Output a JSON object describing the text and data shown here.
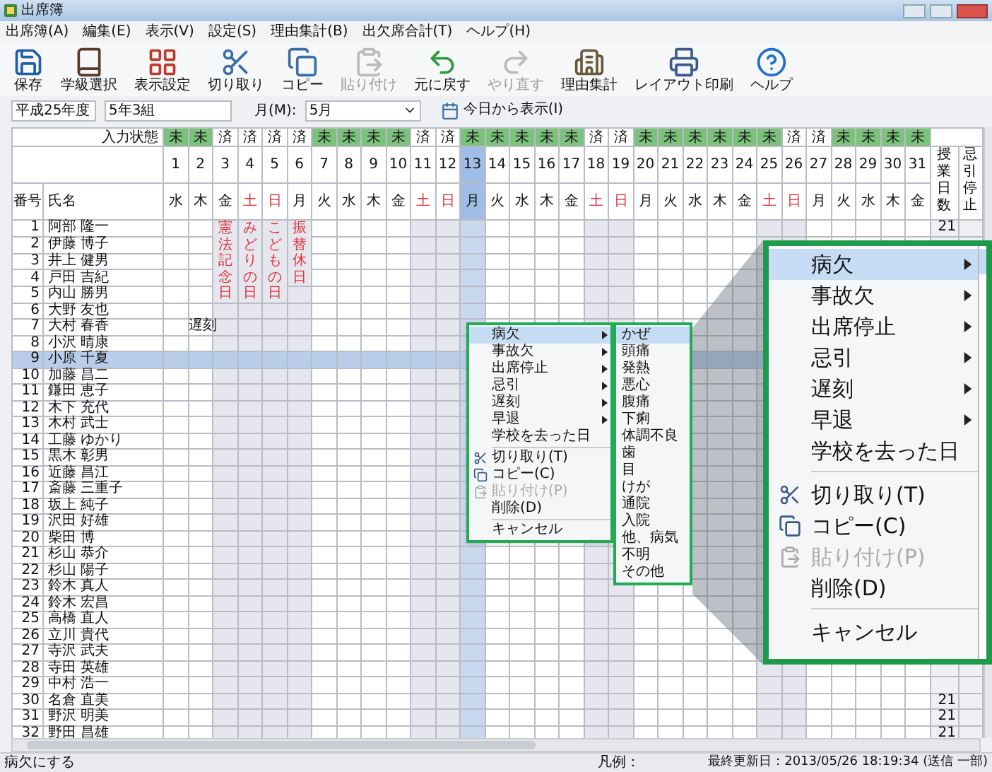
{
  "window": {
    "title": "出席簿"
  },
  "menu_bar": [
    "出席簿(A)",
    "編集(E)",
    "表示(V)",
    "設定(S)",
    "理由集計(B)",
    "出欠席合計(T)",
    "ヘルプ(H)"
  ],
  "toolbar": [
    {
      "label": "保存",
      "kind": "save",
      "disabled": false
    },
    {
      "label": "学級選択",
      "kind": "book",
      "disabled": false
    },
    {
      "label": "表示設定",
      "kind": "grid",
      "disabled": false
    },
    {
      "label": "切り取り",
      "kind": "cut",
      "disabled": false
    },
    {
      "label": "コピー",
      "kind": "copy",
      "disabled": false
    },
    {
      "label": "貼り付け",
      "kind": "paste",
      "disabled": true
    },
    {
      "label": "元に戻す",
      "kind": "undo",
      "disabled": false
    },
    {
      "label": "やり直す",
      "kind": "redo",
      "disabled": true
    },
    {
      "label": "理由集計",
      "kind": "report",
      "disabled": false
    },
    {
      "label": "レイアウト印刷",
      "kind": "print",
      "disabled": false
    },
    {
      "label": "ヘルプ",
      "kind": "help",
      "disabled": false
    }
  ],
  "info_bar": {
    "year": "平成25年度",
    "class": "5年3組",
    "month_label": "月(M):",
    "month_value": "5月",
    "today_button": "今日から表示(I)"
  },
  "grid": {
    "status_label": "入力状態",
    "number_header": "番号",
    "name_header": "氏名",
    "summary_headers": [
      "授業日数",
      "忌引停止"
    ],
    "days": [
      {
        "day": "1",
        "weekday": "水",
        "status": "未",
        "highlighted": true,
        "kind": "school",
        "selected": false
      },
      {
        "day": "2",
        "weekday": "木",
        "status": "未",
        "highlighted": true,
        "kind": "school",
        "selected": false
      },
      {
        "day": "3",
        "weekday": "金",
        "status": "済",
        "highlighted": false,
        "kind": "holiday",
        "selected": false,
        "holiday_text": "憲法記念日"
      },
      {
        "day": "4",
        "weekday": "土",
        "status": "済",
        "highlighted": false,
        "kind": "weekend",
        "selected": false,
        "holiday_text": "みどりの日"
      },
      {
        "day": "5",
        "weekday": "日",
        "status": "済",
        "highlighted": false,
        "kind": "weekend",
        "selected": false,
        "holiday_text": "こどもの日"
      },
      {
        "day": "6",
        "weekday": "月",
        "status": "済",
        "highlighted": false,
        "kind": "holiday",
        "selected": false,
        "holiday_text": "振替休日"
      },
      {
        "day": "7",
        "weekday": "火",
        "status": "未",
        "highlighted": true,
        "kind": "school",
        "selected": false
      },
      {
        "day": "8",
        "weekday": "水",
        "status": "未",
        "highlighted": true,
        "kind": "school",
        "selected": false
      },
      {
        "day": "9",
        "weekday": "木",
        "status": "未",
        "highlighted": true,
        "kind": "school",
        "selected": false
      },
      {
        "day": "10",
        "weekday": "金",
        "status": "未",
        "highlighted": true,
        "kind": "school",
        "selected": false
      },
      {
        "day": "11",
        "weekday": "土",
        "status": "済",
        "highlighted": false,
        "kind": "weekend",
        "selected": false
      },
      {
        "day": "12",
        "weekday": "日",
        "status": "済",
        "highlighted": false,
        "kind": "weekend",
        "selected": false
      },
      {
        "day": "13",
        "weekday": "月",
        "status": "未",
        "highlighted": true,
        "kind": "school",
        "selected": true
      },
      {
        "day": "14",
        "weekday": "火",
        "status": "未",
        "highlighted": true,
        "kind": "school",
        "selected": false
      },
      {
        "day": "15",
        "weekday": "水",
        "status": "未",
        "highlighted": true,
        "kind": "school",
        "selected": false
      },
      {
        "day": "16",
        "weekday": "木",
        "status": "未",
        "highlighted": true,
        "kind": "school",
        "selected": false
      },
      {
        "day": "17",
        "weekday": "金",
        "status": "未",
        "highlighted": true,
        "kind": "school",
        "selected": false
      },
      {
        "day": "18",
        "weekday": "土",
        "status": "済",
        "highlighted": false,
        "kind": "weekend",
        "selected": false
      },
      {
        "day": "19",
        "weekday": "日",
        "status": "済",
        "highlighted": false,
        "kind": "weekend",
        "selected": false
      },
      {
        "day": "20",
        "weekday": "月",
        "status": "未",
        "highlighted": true,
        "kind": "school",
        "selected": false
      },
      {
        "day": "21",
        "weekday": "火",
        "status": "未",
        "highlighted": true,
        "kind": "school",
        "selected": false
      },
      {
        "day": "22",
        "weekday": "水",
        "status": "未",
        "highlighted": true,
        "kind": "school",
        "selected": false
      },
      {
        "day": "23",
        "weekday": "木",
        "status": "未",
        "highlighted": true,
        "kind": "school",
        "selected": false
      },
      {
        "day": "24",
        "weekday": "金",
        "status": "未",
        "highlighted": true,
        "kind": "school",
        "selected": false
      },
      {
        "day": "25",
        "weekday": "土",
        "status": "未",
        "highlighted": true,
        "kind": "weekend",
        "selected": false
      },
      {
        "day": "26",
        "weekday": "日",
        "status": "済",
        "highlighted": false,
        "kind": "weekend",
        "selected": false
      },
      {
        "day": "27",
        "weekday": "月",
        "status": "済",
        "highlighted": false,
        "kind": "school",
        "selected": false
      },
      {
        "day": "28",
        "weekday": "火",
        "status": "未",
        "highlighted": true,
        "kind": "school",
        "selected": false
      },
      {
        "day": "29",
        "weekday": "水",
        "status": "未",
        "highlighted": true,
        "kind": "school",
        "selected": false
      },
      {
        "day": "30",
        "weekday": "木",
        "status": "未",
        "highlighted": true,
        "kind": "school",
        "selected": false
      },
      {
        "day": "31",
        "weekday": "金",
        "status": "未",
        "highlighted": true,
        "kind": "school",
        "selected": false
      }
    ],
    "students": [
      {
        "number": "1",
        "name": "阿部 隆一",
        "selected": false,
        "total": "21"
      },
      {
        "number": "2",
        "name": "伊藤 博子",
        "selected": false
      },
      {
        "number": "3",
        "name": "井上 健男",
        "selected": false
      },
      {
        "number": "4",
        "name": "戸田 吉紀",
        "selected": false
      },
      {
        "number": "5",
        "name": "内山 勝男",
        "selected": false
      },
      {
        "number": "6",
        "name": "大野 友也",
        "selected": false
      },
      {
        "number": "7",
        "name": "大村 春香",
        "selected": false,
        "day_notes": [
          {
            "kind": "blank"
          },
          {
            "kind": "text",
            "text": "遅刻"
          }
        ]
      },
      {
        "number": "8",
        "name": "小沢 晴康",
        "selected": false
      },
      {
        "number": "9",
        "name": "小原 千夏",
        "selected": true
      },
      {
        "number": "10",
        "name": "加藤 昌二",
        "selected": false
      },
      {
        "number": "11",
        "name": "鎌田 恵子",
        "selected": false
      },
      {
        "number": "12",
        "name": "木下 充代",
        "selected": false
      },
      {
        "number": "13",
        "name": "木村 武士",
        "selected": false
      },
      {
        "number": "14",
        "name": "工藤 ゆかり",
        "selected": false
      },
      {
        "number": "15",
        "name": "黒木 彰男",
        "selected": false
      },
      {
        "number": "16",
        "name": "近藤 昌江",
        "selected": false
      },
      {
        "number": "17",
        "name": "斎藤 三重子",
        "selected": false
      },
      {
        "number": "18",
        "name": "坂上 純子",
        "selected": false
      },
      {
        "number": "19",
        "name": "沢田 好雄",
        "selected": false
      },
      {
        "number": "20",
        "name": "柴田 博",
        "selected": false
      },
      {
        "number": "21",
        "name": "杉山 恭介",
        "selected": false
      },
      {
        "number": "22",
        "name": "杉山 陽子",
        "selected": false
      },
      {
        "number": "23",
        "name": "鈴木 真人",
        "selected": false
      },
      {
        "number": "24",
        "name": "鈴木 宏昌",
        "selected": false
      },
      {
        "number": "25",
        "name": "高橋 直人",
        "selected": false
      },
      {
        "number": "26",
        "name": "立川 貴代",
        "selected": false
      },
      {
        "number": "27",
        "name": "寺沢 武夫",
        "selected": false
      },
      {
        "number": "28",
        "name": "寺田 英雄",
        "selected": false
      },
      {
        "number": "29",
        "name": "中村 浩一",
        "selected": false
      },
      {
        "number": "30",
        "name": "名倉 直美",
        "selected": false,
        "total": "21"
      },
      {
        "number": "31",
        "name": "野沢 明美",
        "selected": false,
        "total": "21"
      },
      {
        "number": "32",
        "name": "野田 昌雄",
        "selected": false,
        "total": "21"
      }
    ]
  },
  "context_menu": [
    {
      "label": "病欠",
      "kind": "submenu",
      "selected": true,
      "disabled": false
    },
    {
      "label": "事故欠",
      "kind": "submenu",
      "selected": false,
      "disabled": false
    },
    {
      "label": "出席停止",
      "kind": "submenu",
      "selected": false,
      "disabled": false
    },
    {
      "label": "忌引",
      "kind": "submenu",
      "selected": false,
      "disabled": false
    },
    {
      "label": "遅刻",
      "kind": "submenu",
      "selected": false,
      "disabled": false
    },
    {
      "label": "早退",
      "kind": "submenu",
      "selected": false,
      "disabled": false
    },
    {
      "label": "学校を去った日",
      "kind": "plain",
      "selected": false,
      "disabled": false
    },
    {
      "label": "切り取り(T)",
      "kind": "cut",
      "selected": false,
      "disabled": false,
      "separator_before": true
    },
    {
      "label": "コピー(C)",
      "kind": "copy",
      "selected": false,
      "disabled": false
    },
    {
      "label": "貼り付け(P)",
      "kind": "paste",
      "selected": false,
      "disabled": true
    },
    {
      "label": "削除(D)",
      "kind": "plain",
      "selected": false,
      "disabled": false
    },
    {
      "label": "キャンセル",
      "kind": "plain",
      "selected": false,
      "disabled": false,
      "separator_before": true
    }
  ],
  "reason_submenu": [
    {
      "label": "かぜ",
      "selected": true
    },
    {
      "label": "頭痛",
      "selected": false
    },
    {
      "label": "発熱",
      "selected": false
    },
    {
      "label": "悪心",
      "selected": false
    },
    {
      "label": "腹痛",
      "selected": false
    },
    {
      "label": "下痢",
      "selected": false
    },
    {
      "label": "体調不良",
      "selected": false
    },
    {
      "label": "歯",
      "selected": false
    },
    {
      "label": "目",
      "selected": false
    },
    {
      "label": "けが",
      "selected": false
    },
    {
      "label": "通院",
      "selected": false
    },
    {
      "label": "入院",
      "selected": false
    },
    {
      "label": "他、病気",
      "selected": false
    },
    {
      "label": "不明",
      "selected": false
    },
    {
      "label": "その他",
      "selected": false
    }
  ],
  "zoomed_menu": [
    {
      "label": "病欠",
      "kind": "submenu",
      "selected": true,
      "disabled": false
    },
    {
      "label": "事故欠",
      "kind": "submenu",
      "selected": false,
      "disabled": false
    },
    {
      "label": "出席停止",
      "kind": "submenu",
      "selected": false,
      "disabled": false
    },
    {
      "label": "忌引",
      "kind": "submenu",
      "selected": false,
      "disabled": false
    },
    {
      "label": "遅刻",
      "kind": "submenu",
      "selected": false,
      "disabled": false
    },
    {
      "label": "早退",
      "kind": "submenu",
      "selected": false,
      "disabled": false
    },
    {
      "label": "学校を去った日",
      "kind": "plain",
      "selected": false,
      "disabled": false
    },
    {
      "label": "切り取り(T)",
      "kind": "cut",
      "selected": false,
      "disabled": false,
      "separator_before": true
    },
    {
      "label": "コピー(C)",
      "kind": "copy",
      "selected": false,
      "disabled": false
    },
    {
      "label": "貼り付け(P)",
      "kind": "paste",
      "selected": false,
      "disabled": true
    },
    {
      "label": "削除(D)",
      "kind": "plain",
      "selected": false,
      "disabled": false
    },
    {
      "label": "キャンセル",
      "kind": "plain",
      "selected": false,
      "disabled": false,
      "separator_before": true
    }
  ],
  "status_bar": {
    "message": "病欠にする",
    "legend": "凡例：",
    "updated": "最終更新日：2013/05/26 18:19:34 (送信 一部)"
  }
}
